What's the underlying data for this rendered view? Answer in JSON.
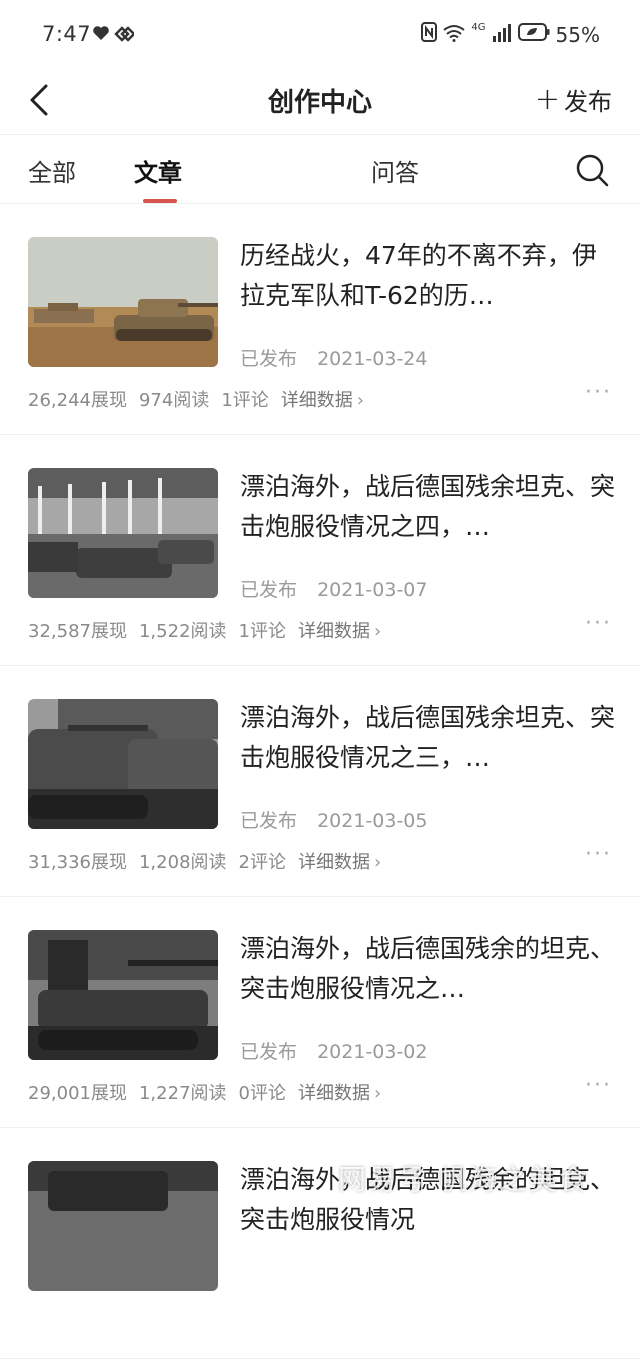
{
  "status_bar": {
    "time": "7:47",
    "network": "4G",
    "battery": "55%"
  },
  "navbar": {
    "back_icon": "chevron-left-icon",
    "title": "创作中心",
    "publish_label": "发布"
  },
  "tabs": {
    "items": [
      {
        "label": "全部",
        "active": false
      },
      {
        "label": "文章",
        "active": true
      },
      {
        "label": "问答",
        "active": false
      }
    ],
    "accent_color": "#d9534f"
  },
  "articles": [
    {
      "title": "历经战火，47年的不离不弃，伊拉克军队和T-62的历…",
      "status": "已发布",
      "date": "2021-03-24",
      "views": "26,244展现",
      "reads": "974阅读",
      "comments": "1评论",
      "detail": "详细数据"
    },
    {
      "title": "漂泊海外，战后德国残余坦克、突击炮服役情况之四，…",
      "status": "已发布",
      "date": "2021-03-07",
      "views": "32,587展现",
      "reads": "1,522阅读",
      "comments": "1评论",
      "detail": "详细数据"
    },
    {
      "title": "漂泊海外，战后德国残余坦克、突击炮服役情况之三，…",
      "status": "已发布",
      "date": "2021-03-05",
      "views": "31,336展现",
      "reads": "1,208阅读",
      "comments": "2评论",
      "detail": "详细数据"
    },
    {
      "title": "漂泊海外，战后德国残余的坦克、突击炮服役情况之…",
      "status": "已发布",
      "date": "2021-03-02",
      "views": "29,001展现",
      "reads": "1,227阅读",
      "comments": "0评论",
      "detail": "详细数据"
    },
    {
      "title": "漂泊海外，战后德国残余的坦克、突击炮服役情况",
      "status": "",
      "date": "",
      "views": "",
      "reads": "",
      "comments": "",
      "detail": ""
    }
  ],
  "watermark": "网易号 帆海之美食"
}
